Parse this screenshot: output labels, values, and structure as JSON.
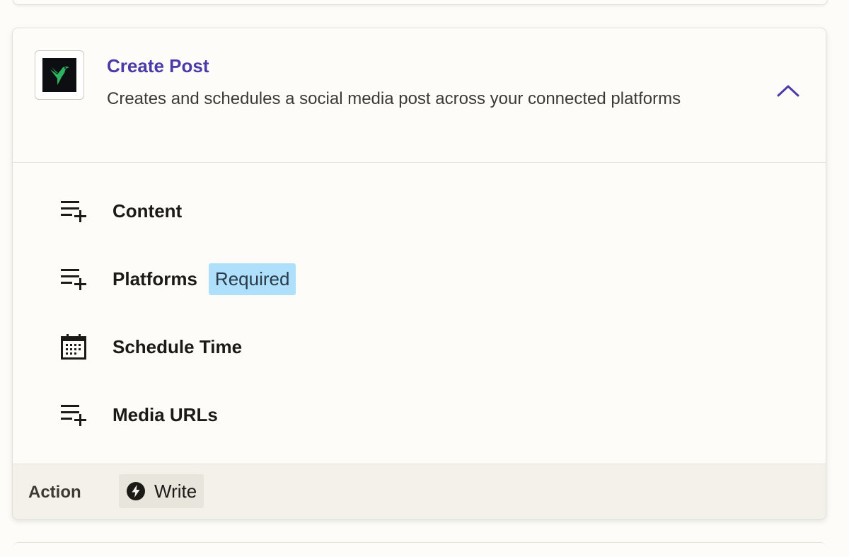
{
  "action": {
    "title": "Create Post",
    "description": "Creates and schedules a social media post across your connected platforms",
    "app_icon": "hummingbird-logo-icon",
    "toggle_icon": "chevron-up-icon"
  },
  "fields": [
    {
      "label": "Content",
      "icon": "text-add-icon",
      "required": ""
    },
    {
      "label": "Platforms",
      "icon": "text-add-icon",
      "required": "Required"
    },
    {
      "label": "Schedule Time",
      "icon": "calendar-icon",
      "required": ""
    },
    {
      "label": "Media URLs",
      "icon": "text-add-icon",
      "required": ""
    }
  ],
  "footer": {
    "label": "Action",
    "type_label": "Write",
    "type_icon": "bolt-icon"
  },
  "colors": {
    "title": "#4b3ba8",
    "required_badge": "#aee0fb",
    "footer_bg": "#f3f1ea"
  }
}
